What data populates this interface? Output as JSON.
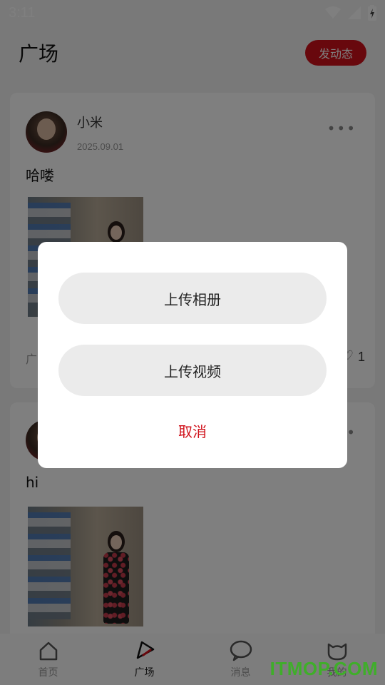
{
  "status_bar": {
    "time": "3:11"
  },
  "header": {
    "title": "广场",
    "post_button": "发动态"
  },
  "feed": [
    {
      "username": "小米",
      "date": "2025.09.01",
      "text": "哈喽",
      "footer": "广",
      "likes": "1"
    },
    {
      "text": "hi"
    }
  ],
  "tabbar": [
    {
      "label": "首页",
      "icon": "home-icon"
    },
    {
      "label": "广场",
      "icon": "plaza-icon"
    },
    {
      "label": "消息",
      "icon": "message-icon"
    },
    {
      "label": "我的",
      "icon": "profile-icon"
    }
  ],
  "dialog": {
    "upload_album": "上传相册",
    "upload_video": "上传视频",
    "cancel": "取消"
  },
  "watermark": "ITMOP.COM",
  "colors": {
    "accent": "#d0101a",
    "overlay": "rgba(0,0,0,0.5)",
    "option_bg": "#ebebeb"
  }
}
